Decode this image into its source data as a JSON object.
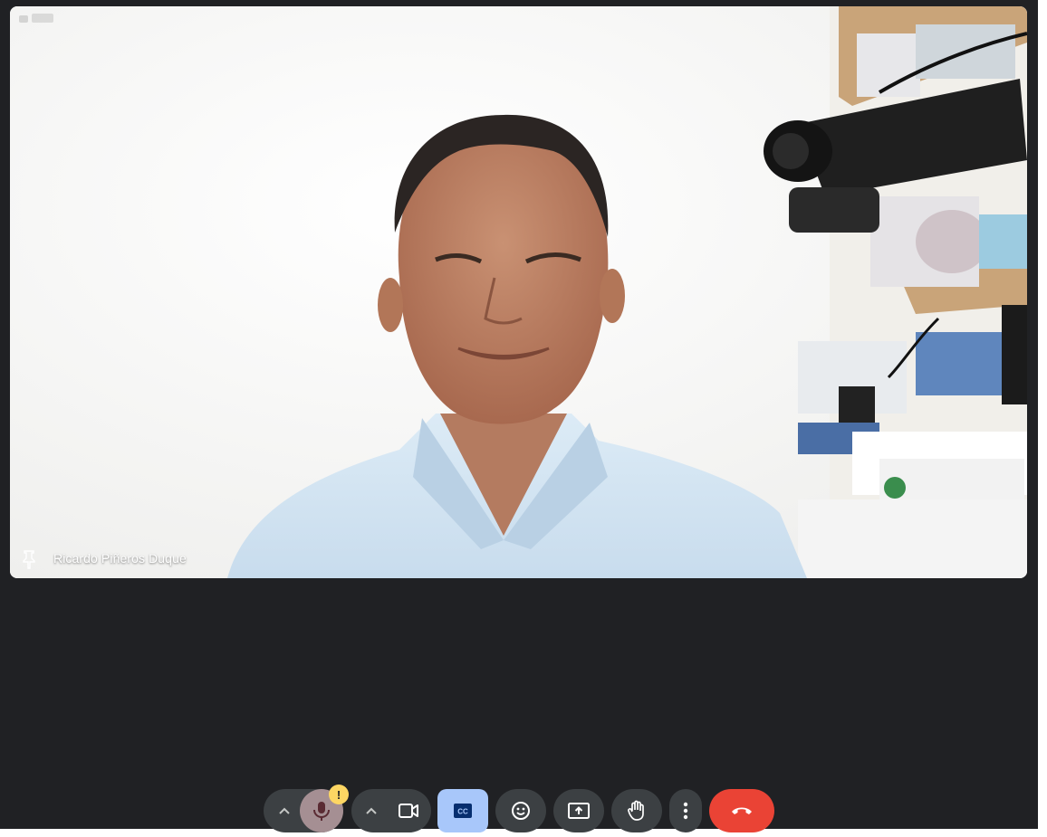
{
  "participant": {
    "name": "Ricardo Piñeros Duque",
    "pinned": false
  },
  "controls": {
    "mic": {
      "icon": "mic-icon",
      "warning_badge": "!",
      "menu_icon": "chevron-up-icon"
    },
    "camera": {
      "icon": "videocam-icon",
      "menu_icon": "chevron-up-icon"
    },
    "captions": {
      "icon": "closed-captions-icon",
      "active": true
    },
    "reactions": {
      "icon": "emoji-icon"
    },
    "present": {
      "icon": "present-screen-icon"
    },
    "raise_hand": {
      "icon": "raise-hand-icon"
    },
    "more": {
      "icon": "more-vert-icon"
    },
    "leave": {
      "icon": "call-end-icon"
    }
  },
  "colors": {
    "background": "#202124",
    "control": "#3c4043",
    "captions_active": "#a8c7fa",
    "end_call": "#ea4335",
    "warning": "#fdd663"
  }
}
